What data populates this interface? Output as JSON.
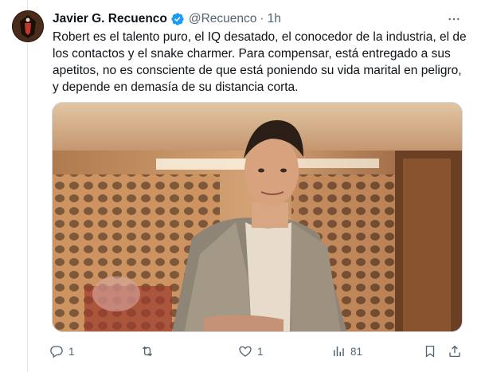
{
  "tweet": {
    "author": {
      "display_name": "Javier G. Recuenco",
      "handle": "@Recuenco",
      "verified": true
    },
    "separator": "·",
    "time": "1h",
    "text": "Robert es el talento puro, el IQ desatado, el conocedor de la industria, el de los contactos y el snake charmer. Para compensar, está entregado a sus apetitos, no es consciente de que está poniendo su vida marital en peligro, y depende en demasía de su distancia corta.",
    "media": {
      "type": "photo"
    },
    "actions": {
      "reply_count": "1",
      "retweet_count": "",
      "like_count": "1",
      "views_count": "81"
    }
  },
  "colors": {
    "text_primary": "#0f1419",
    "text_secondary": "#536471",
    "verified": "#1d9bf0",
    "border": "#cfd9de"
  },
  "icons": [
    "verified-badge-icon",
    "more-icon",
    "reply-icon",
    "retweet-icon",
    "like-icon",
    "views-icon",
    "bookmark-icon",
    "share-icon"
  ]
}
